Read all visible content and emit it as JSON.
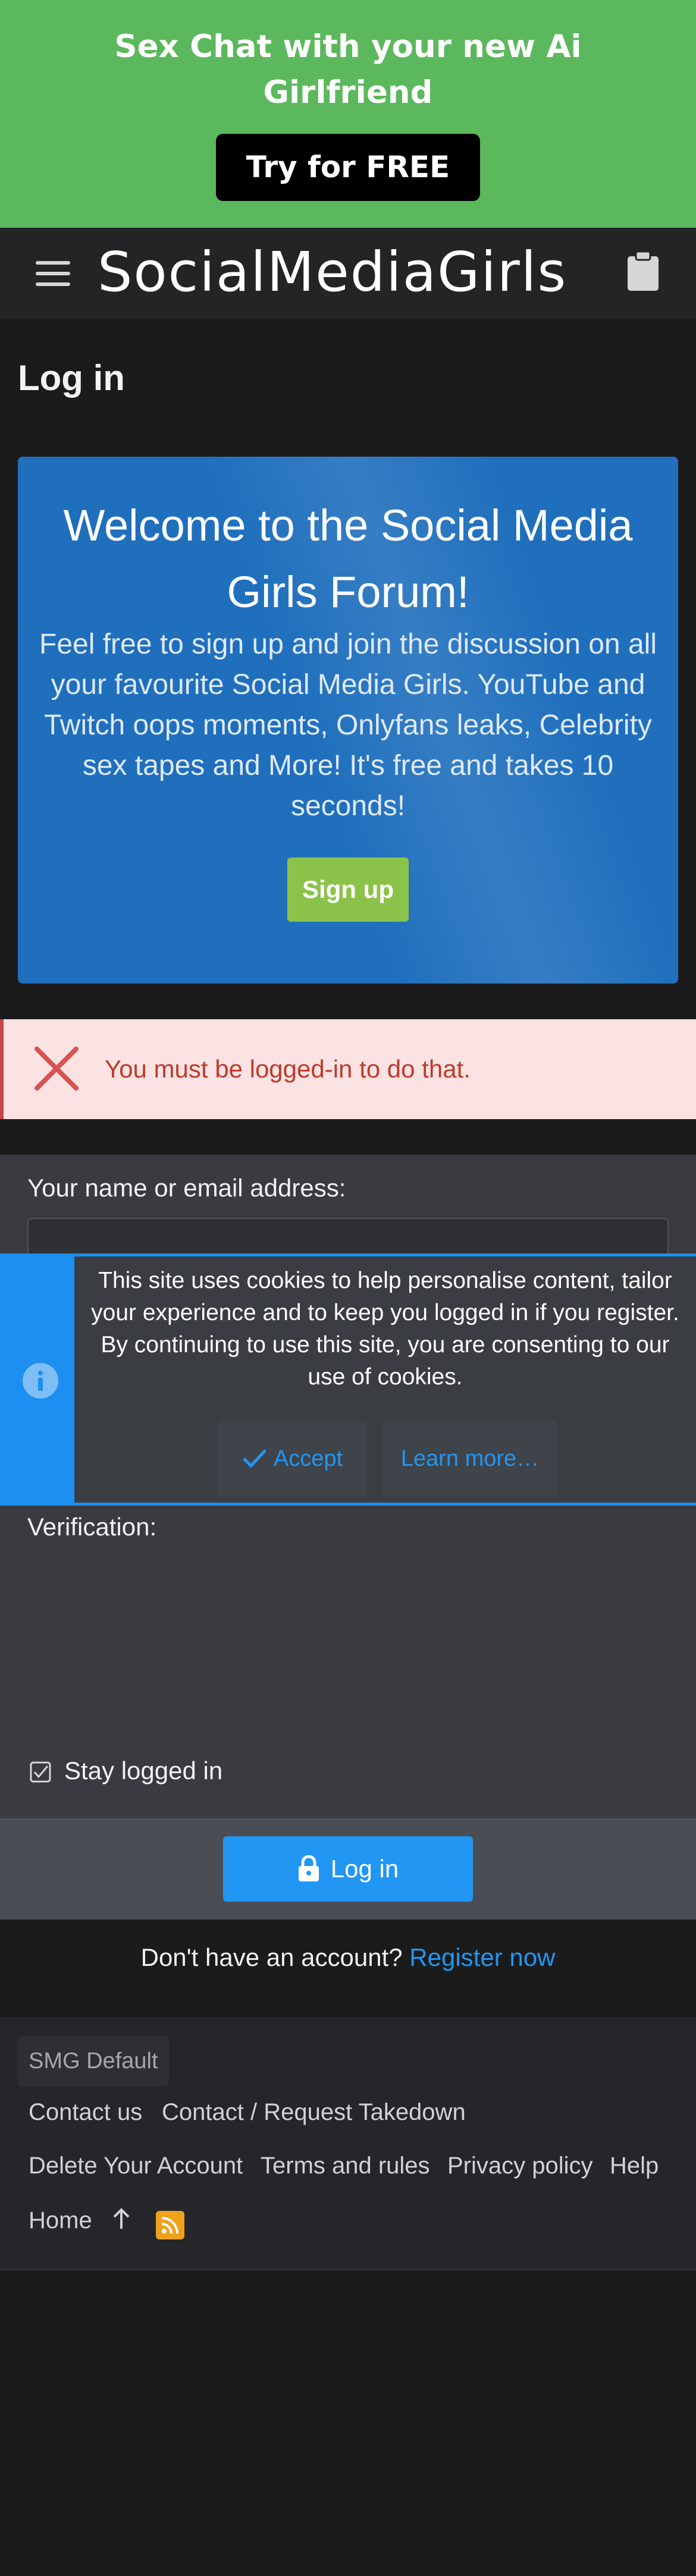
{
  "ad": {
    "title_line1": "Sex Chat with your new Ai",
    "title_line2": "Girlfriend",
    "cta": "Try for FREE"
  },
  "header": {
    "logo": "SocialMediaGirls",
    "menu_icon": "hamburger-menu-icon",
    "clipboard_icon": "clipboard-icon"
  },
  "page": {
    "title": "Log in"
  },
  "welcome": {
    "title_line1": "Welcome to the Social Media",
    "title_line2": "Girls Forum!",
    "text_lines": [
      "Feel free to sign up and join the discussion on all",
      "your favourite Social Media Girls. YouTube and",
      "Twitch oops moments, Onlyfans leaks, Celebrity",
      "sex tapes and More! It's free and takes 10",
      "seconds!"
    ],
    "signup": "Sign up"
  },
  "error": {
    "message": "You must be logged-in to do that."
  },
  "form": {
    "name_label": "Your name or email address:",
    "name_value": "",
    "verification_label": "Verification:",
    "stay_logged_in": "Stay logged in",
    "login_button": "Log in"
  },
  "cookie": {
    "lines": [
      "This site uses cookies to help personalise content, tailor",
      "your experience and to keep you logged in if you register.",
      "By continuing to use this site, you are consenting to our",
      "use of cookies."
    ],
    "accept": "Accept",
    "learn_more": "Learn more…"
  },
  "register": {
    "prompt": "Don't have an account?",
    "link": "Register now"
  },
  "footer": {
    "style": "SMG Default",
    "links_row1": [
      "Contact us",
      "Contact / Request Takedown"
    ],
    "links_row2": [
      "Delete Your Account",
      "Terms and rules",
      "Privacy policy",
      "Help"
    ],
    "home": "Home"
  },
  "colors": {
    "ad_bg": "#5cb85c",
    "accent_blue": "#2196f3",
    "signup_green": "#8bc34a",
    "error_red": "#c0392b",
    "rss_orange": "#f0a11b"
  }
}
